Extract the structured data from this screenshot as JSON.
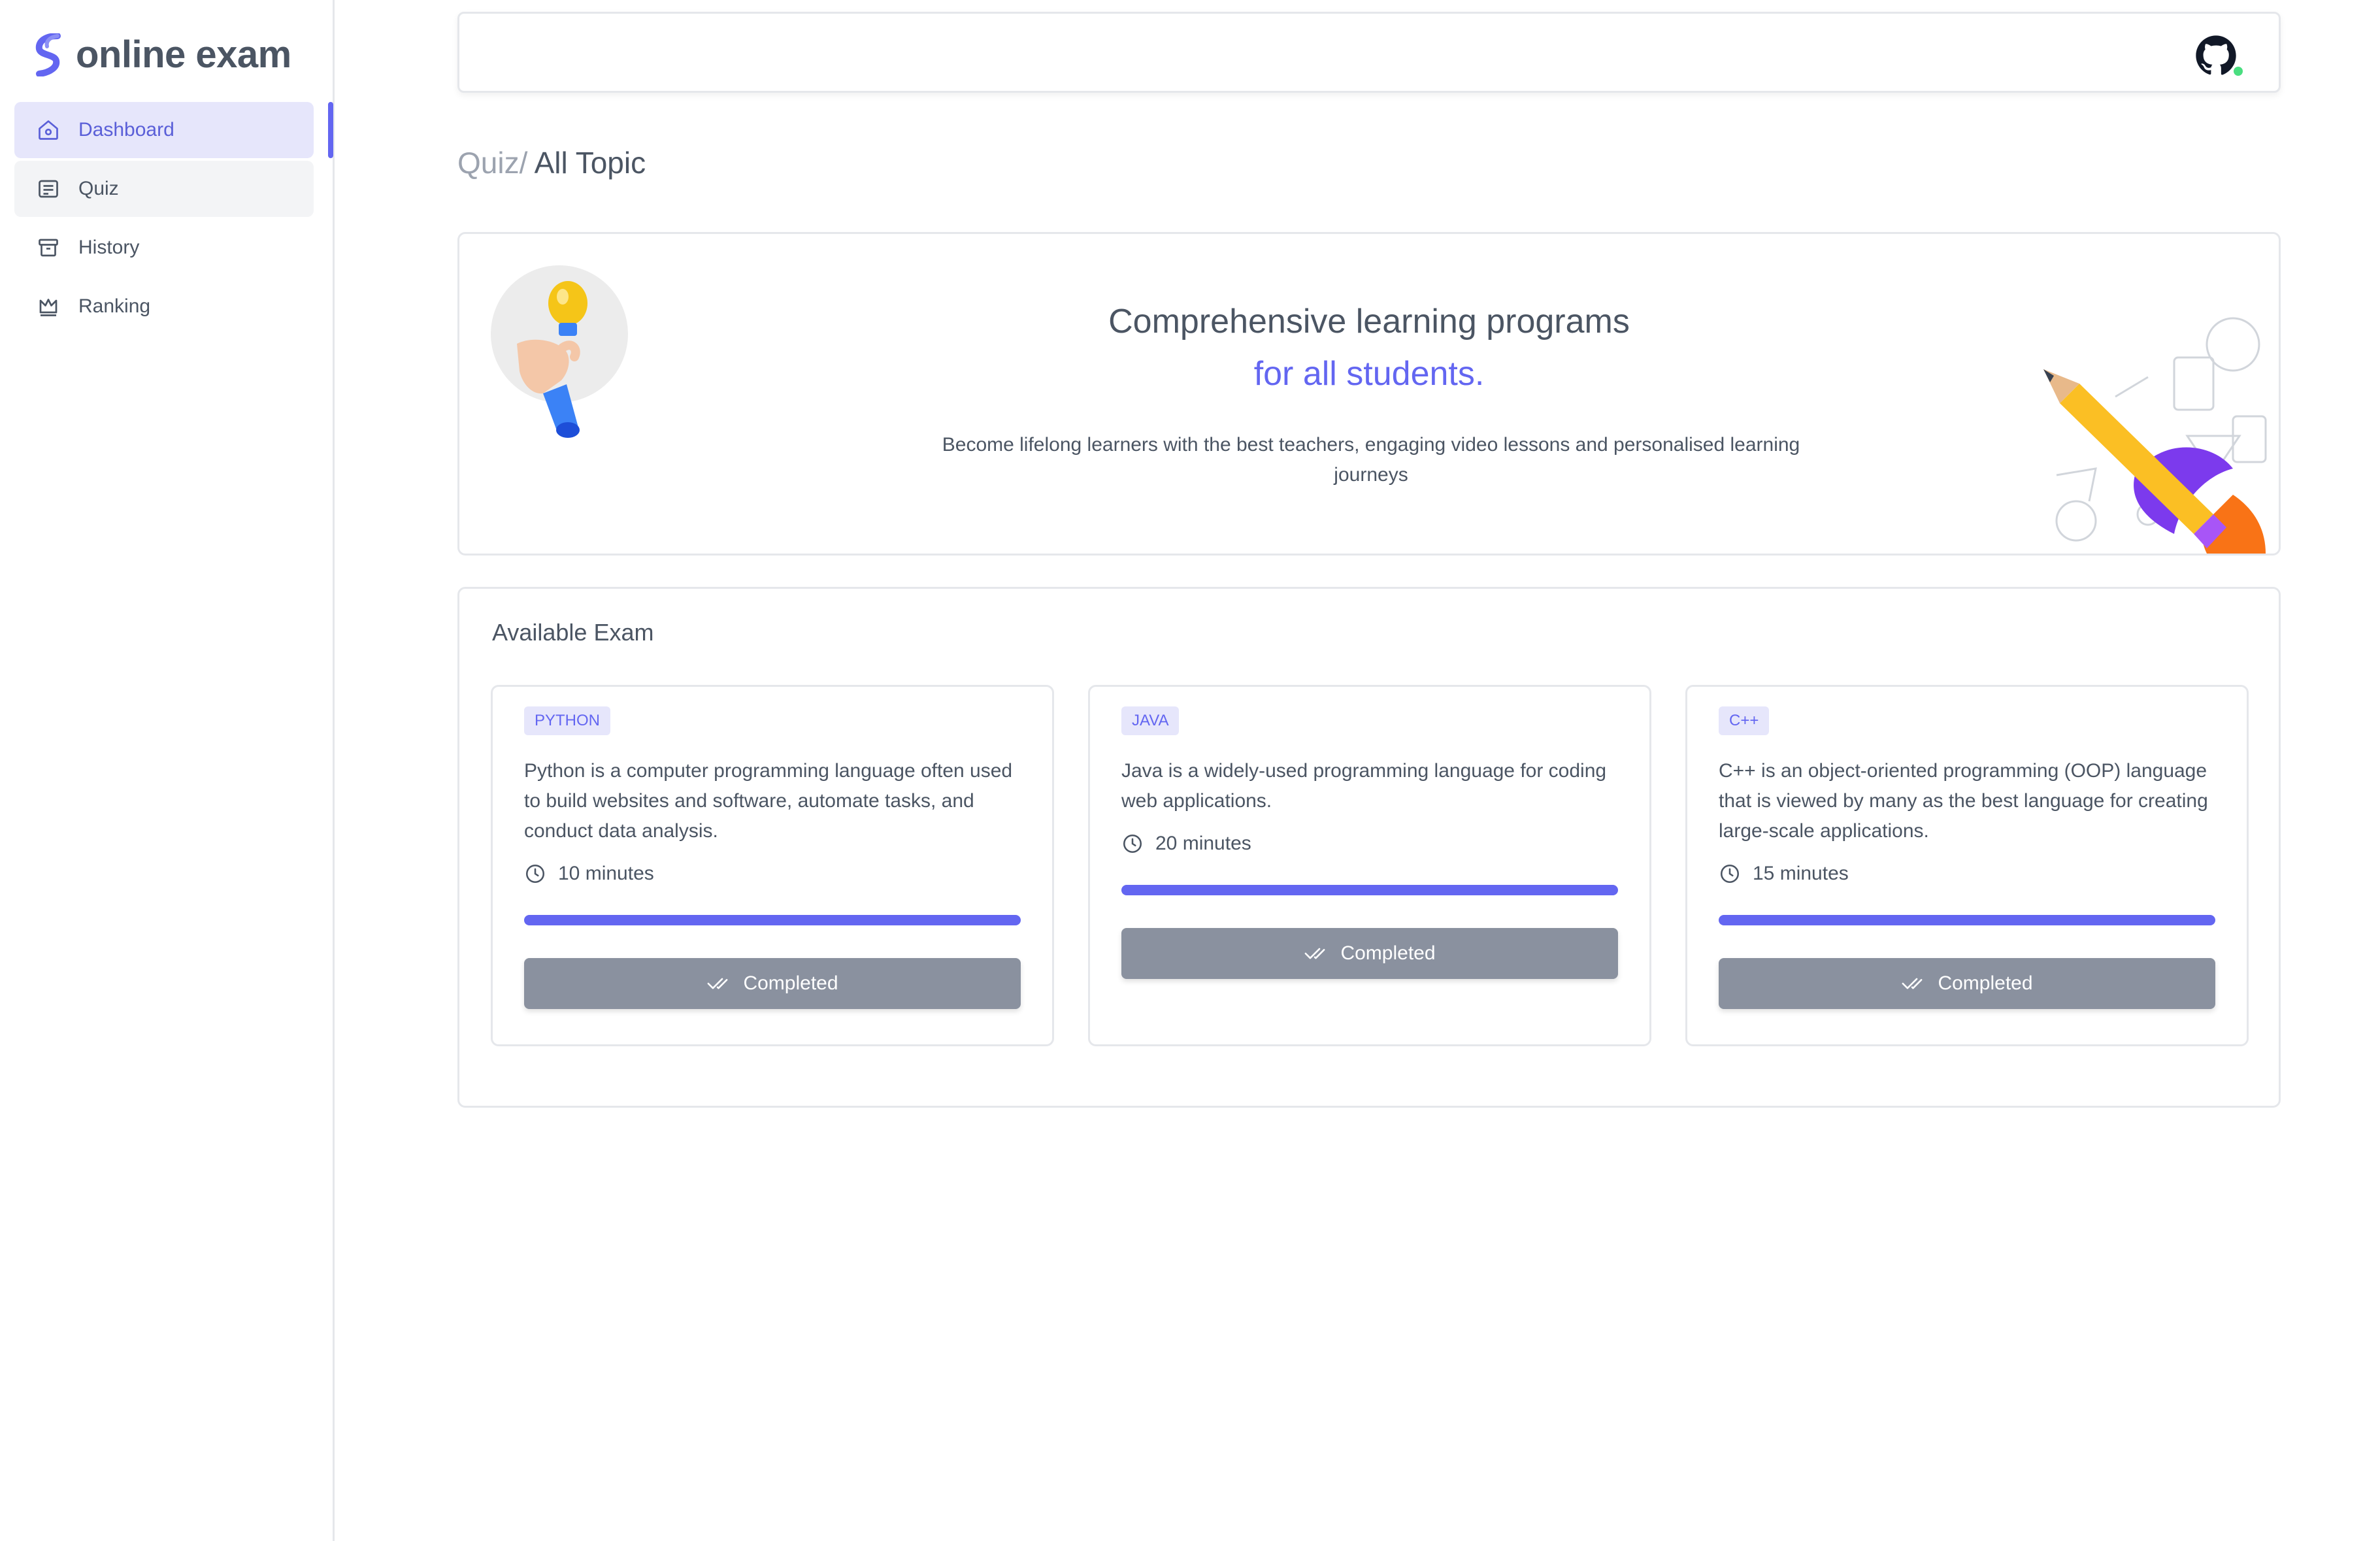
{
  "brand": {
    "name": "online exam",
    "accent": "#6366f1"
  },
  "sidebar": {
    "items": [
      {
        "label": "Dashboard",
        "icon": "home-icon",
        "active": true
      },
      {
        "label": "Quiz",
        "icon": "list-icon",
        "active": false
      },
      {
        "label": "History",
        "icon": "archive-icon",
        "active": false
      },
      {
        "label": "Ranking",
        "icon": "crown-icon",
        "active": false
      }
    ]
  },
  "topbar": {
    "icon": "github-icon",
    "status_color": "#4ade80"
  },
  "breadcrumb": {
    "parent": "Quiz/",
    "current": "All Topic"
  },
  "hero": {
    "title": "Comprehensive learning programs",
    "subtitle": "for all students.",
    "description": "Become lifelong learners with the best teachers, engaging video lessons and personalised learning journeys"
  },
  "exams": {
    "title": "Available Exam",
    "cards": [
      {
        "tag": "PYTHON",
        "description": "Python is a computer programming language often used to build websites and software, automate tasks, and conduct data analysis.",
        "duration": "10 minutes",
        "progress": 1.0,
        "button": "Completed"
      },
      {
        "tag": "JAVA",
        "description": "Java is a widely-used programming language for coding web applications.",
        "duration": "20 minutes",
        "progress": 1.0,
        "button": "Completed"
      },
      {
        "tag": "C++",
        "description": "C++ is an object-oriented programming (OOP) language that is viewed by many as the best language for creating large-scale applications.",
        "duration": "15 minutes",
        "progress": 1.0,
        "button": "Completed"
      }
    ]
  }
}
